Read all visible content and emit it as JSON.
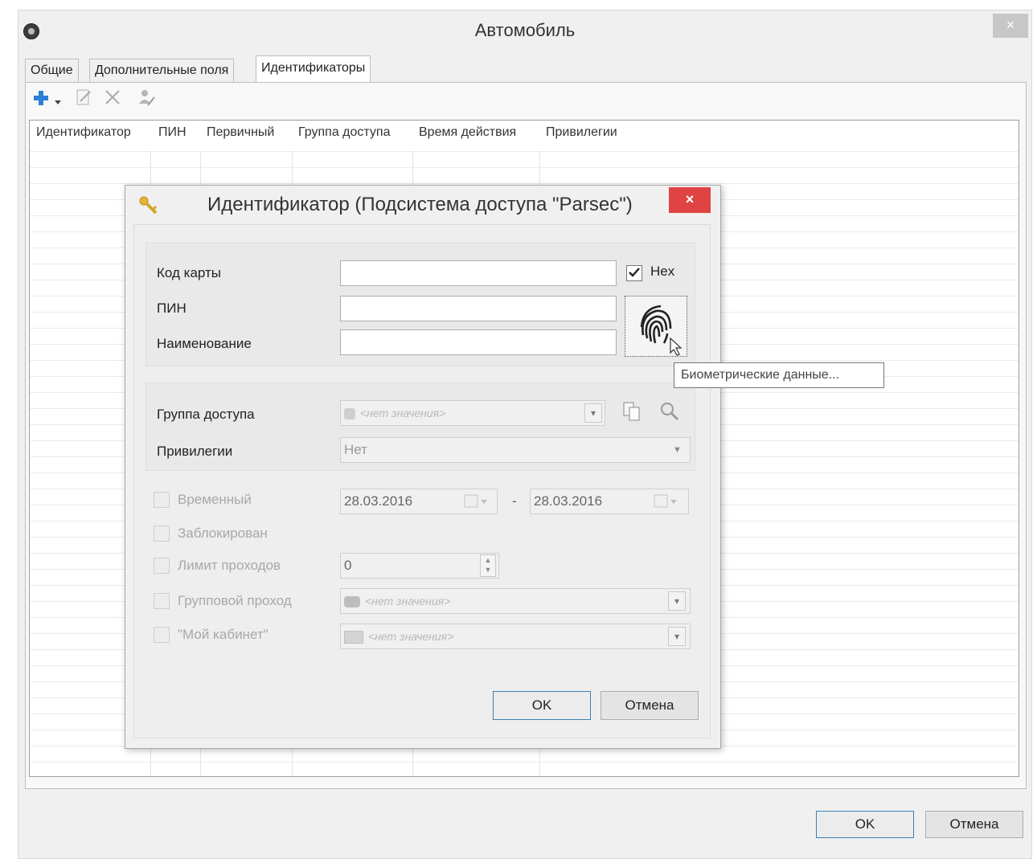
{
  "window": {
    "title": "Автомобиль",
    "close_glyph": "×",
    "icon": "app-logo-icon"
  },
  "tabs": [
    {
      "label": "Общие",
      "active": false
    },
    {
      "label": "Дополнительные поля",
      "active": false
    },
    {
      "label": "Идентификаторы",
      "active": true
    }
  ],
  "toolbar": {
    "icons": [
      "add-icon",
      "dropdown-arrow-icon",
      "edit-icon",
      "delete-icon",
      "user-assign-icon"
    ]
  },
  "grid": {
    "columns": [
      "Идентификатор",
      "ПИН",
      "Первичный",
      "Группа доступа",
      "Время действия",
      "Привилегии"
    ]
  },
  "footer": {
    "ok_label": "OK",
    "cancel_label": "Отмена"
  },
  "dialog": {
    "title": "Идентификатор (Подсистема доступа \"Parsec\")",
    "close_glyph": "×",
    "card_code_label": "Код карты",
    "card_code_value": "",
    "hex_label": "Hex",
    "hex_checked": true,
    "pin_label": "ПИН",
    "pin_value": "",
    "name_label": "Наименование",
    "name_value": "",
    "biometric_tooltip": "Биометрические данные...",
    "access_group_label": "Группа доступа",
    "access_group_placeholder": "<нет значения>",
    "privileges_label": "Привилегии",
    "privileges_value": "Нет",
    "temporary_label": "Временный",
    "date_from": "28.03.2016",
    "date_separator": "-",
    "date_to": "28.03.2016",
    "blocked_label": "Заблокирован",
    "pass_limit_label": "Лимит проходов",
    "pass_limit_value": "0",
    "group_pass_label": "Групповой проход",
    "group_pass_placeholder": "<нет значения>",
    "my_cabinet_label": "\"Мой кабинет\"",
    "my_cabinet_placeholder": "<нет значения>",
    "ok_label": "OK",
    "cancel_label": "Отмена"
  },
  "colors": {
    "accent_blue": "#3c7fb1",
    "close_red": "#e04343",
    "add_icon_blue": "#2f7fd6"
  }
}
